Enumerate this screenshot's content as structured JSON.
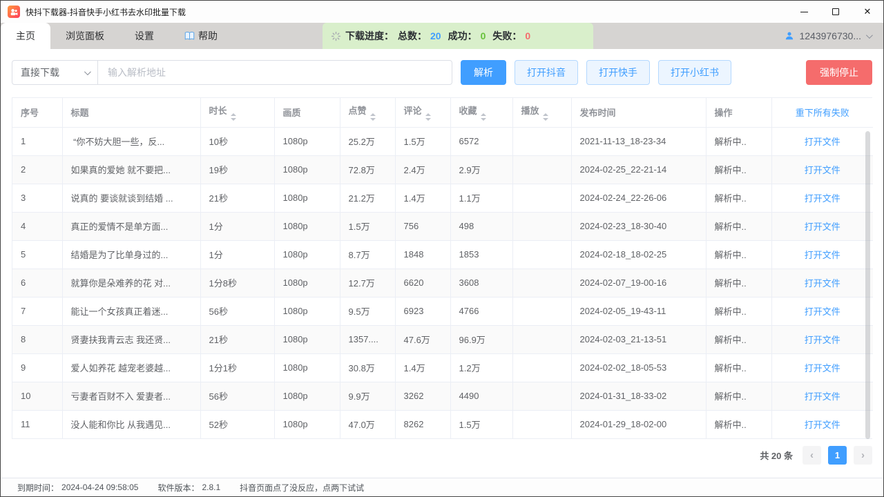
{
  "titlebar": {
    "title": "快抖下载器-抖音快手小红书去水印批量下载",
    "close_glyph": "✕"
  },
  "tabs": [
    {
      "label": "主页",
      "active": true
    },
    {
      "label": "浏览面板",
      "active": false
    },
    {
      "label": "设置",
      "active": false
    },
    {
      "label": "帮助",
      "active": false,
      "icon": "book-icon"
    }
  ],
  "progress": {
    "label": "下载进度：",
    "total_label": "总数：",
    "total": "20",
    "success_label": "成功：",
    "success": "0",
    "fail_label": "失败：",
    "fail": "0"
  },
  "user": {
    "id": "1243976730..."
  },
  "toolbar": {
    "mode_select": "直接下载",
    "input_value": "",
    "input_placeholder": "输入解析地址",
    "parse": "解析",
    "open_douyin": "打开抖音",
    "open_kuaishou": "打开快手",
    "open_xiaohongshu": "打开小红书",
    "force_stop": "强制停止"
  },
  "table": {
    "headers": [
      {
        "key": "index",
        "label": "序号",
        "sortable": false
      },
      {
        "key": "title",
        "label": "标题",
        "sortable": false
      },
      {
        "key": "duration",
        "label": "时长",
        "sortable": true
      },
      {
        "key": "quality",
        "label": "画质",
        "sortable": false
      },
      {
        "key": "likes",
        "label": "点赞",
        "sortable": true
      },
      {
        "key": "comments",
        "label": "评论",
        "sortable": true
      },
      {
        "key": "favorites",
        "label": "收藏",
        "sortable": true
      },
      {
        "key": "plays",
        "label": "播放",
        "sortable": true
      },
      {
        "key": "publish",
        "label": "发布时间",
        "sortable": false
      },
      {
        "key": "action",
        "label": "操作",
        "sortable": false
      },
      {
        "key": "open_file",
        "label": "重下所有失败",
        "sortable": false,
        "link": true
      }
    ],
    "rows": [
      [
        "1",
        " “你不妨大胆一些，反...",
        "10秒",
        "1080p",
        "25.2万",
        "1.5万",
        "6572",
        "",
        "2021-11-13_18-23-34",
        "解析中..",
        "打开文件"
      ],
      [
        "2",
        "如果真的爱她 就不要把...",
        "19秒",
        "1080p",
        "72.8万",
        "2.4万",
        "2.9万",
        "",
        "2024-02-25_22-21-14",
        "解析中..",
        "打开文件"
      ],
      [
        "3",
        "说真的 要谈就谈到结婚 ...",
        "21秒",
        "1080p",
        "21.2万",
        "1.4万",
        "1.1万",
        "",
        "2024-02-24_22-26-06",
        "解析中..",
        "打开文件"
      ],
      [
        "4",
        "真正的爱情不是单方面...",
        "1分",
        "1080p",
        "1.5万",
        "756",
        "498",
        "",
        "2024-02-23_18-30-40",
        "解析中..",
        "打开文件"
      ],
      [
        "5",
        "结婚是为了比单身过的...",
        "1分",
        "1080p",
        "8.7万",
        "1848",
        "1853",
        "",
        "2024-02-18_18-02-25",
        "解析中..",
        "打开文件"
      ],
      [
        "6",
        "就算你是朵难养的花 对...",
        "1分8秒",
        "1080p",
        "12.7万",
        "6620",
        "3608",
        "",
        "2024-02-07_19-00-16",
        "解析中..",
        "打开文件"
      ],
      [
        "7",
        "能让一个女孩真正着迷...",
        "56秒",
        "1080p",
        "9.5万",
        "6923",
        "4766",
        "",
        "2024-02-05_19-43-11",
        "解析中..",
        "打开文件"
      ],
      [
        "8",
        "贤妻扶我青云志 我还贤...",
        "21秒",
        "1080p",
        "1357....",
        "47.6万",
        "96.9万",
        "",
        "2024-02-03_21-13-51",
        "解析中..",
        "打开文件"
      ],
      [
        "9",
        "爱人如养花 越宠老婆越...",
        "1分1秒",
        "1080p",
        "30.8万",
        "1.4万",
        "1.2万",
        "",
        "2024-02-02_18-05-53",
        "解析中..",
        "打开文件"
      ],
      [
        "10",
        "亏妻者百财不入 爱妻者...",
        "56秒",
        "1080p",
        "9.9万",
        "3262",
        "4490",
        "",
        "2024-01-31_18-33-02",
        "解析中..",
        "打开文件"
      ],
      [
        "11",
        "没人能和你比 从我遇见...",
        "52秒",
        "1080p",
        "47.0万",
        "8262",
        "1.5万",
        "",
        "2024-01-29_18-02-00",
        "解析中..",
        "打开文件"
      ]
    ]
  },
  "pagination": {
    "total": "共 20 条",
    "prev": "‹",
    "page": "1",
    "next": "›"
  },
  "statusbar": {
    "expire_label": "到期时间：",
    "expire": "2024-04-24 09:58:05",
    "version_label": "软件版本：",
    "version": "2.8.1",
    "tip": "抖音页面点了没反应，点两下试试"
  },
  "colors": {
    "primary": "#409eff",
    "danger": "#f56c6c",
    "success": "#67c23a",
    "link": "#409eff",
    "progress_bg": "#d9efcb",
    "tabbar_bg": "#d6d4d2"
  },
  "icons": {
    "app": "kuaishou-camera-icon",
    "progress": "loading-spinner-icon",
    "user": "person-icon",
    "help": "open-book-icon"
  }
}
